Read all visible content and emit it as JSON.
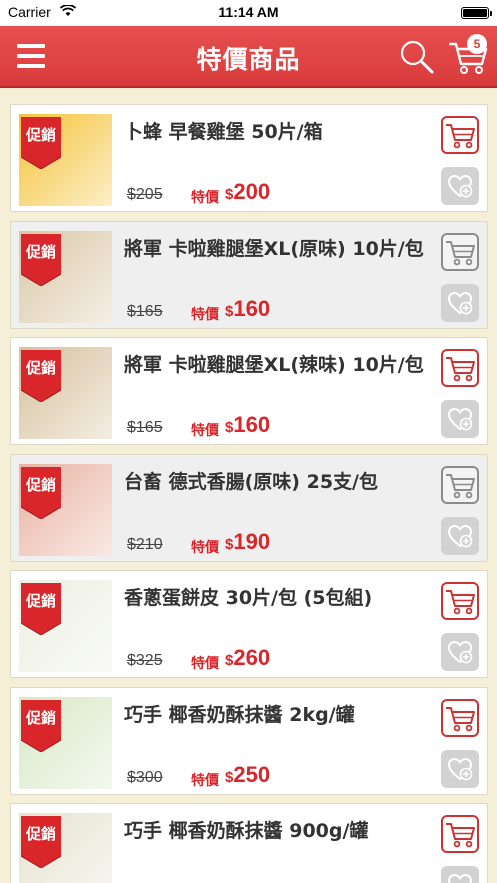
{
  "status_bar": {
    "carrier": "Carrier",
    "time": "11:14 AM"
  },
  "nav": {
    "title": "特價商品",
    "cart_count": "5"
  },
  "promo_label": "促銷",
  "special_label": "特價",
  "currency": "$",
  "products": [
    {
      "name": "卜蜂 早餐雞堡 50片/箱",
      "original_price": "$205",
      "special_price": "200",
      "image_color": "#f5c43a",
      "style": "white",
      "cart_style": "red"
    },
    {
      "name": "將軍 卡啦雞腿堡XL(原味) 10片/包",
      "original_price": "$165",
      "special_price": "160",
      "image_color": "#d9c7a6",
      "style": "gray",
      "cart_style": "gray"
    },
    {
      "name": "將軍 卡啦雞腿堡XL(辣味) 10片/包",
      "original_price": "$165",
      "special_price": "160",
      "image_color": "#d6c19c",
      "style": "white",
      "cart_style": "red"
    },
    {
      "name": "台畜 德式香腸(原味) 25支/包",
      "original_price": "$210",
      "special_price": "190",
      "image_color": "#e9b2a2",
      "style": "gray",
      "cart_style": "gray"
    },
    {
      "name": "香蔥蛋餅皮 30片/包 (5包組)",
      "original_price": "$325",
      "special_price": "260",
      "image_color": "#ecefe3",
      "style": "white",
      "cart_style": "red"
    },
    {
      "name": "巧手 椰香奶酥抹醬 2kg/罐",
      "original_price": "$300",
      "special_price": "250",
      "image_color": "#d8e8c6",
      "style": "white",
      "cart_style": "red"
    },
    {
      "name": "巧手 椰香奶酥抹醬 900g/罐",
      "original_price": "",
      "special_price": "",
      "image_color": "#e5e3cf",
      "style": "white",
      "cart_style": "red"
    }
  ]
}
